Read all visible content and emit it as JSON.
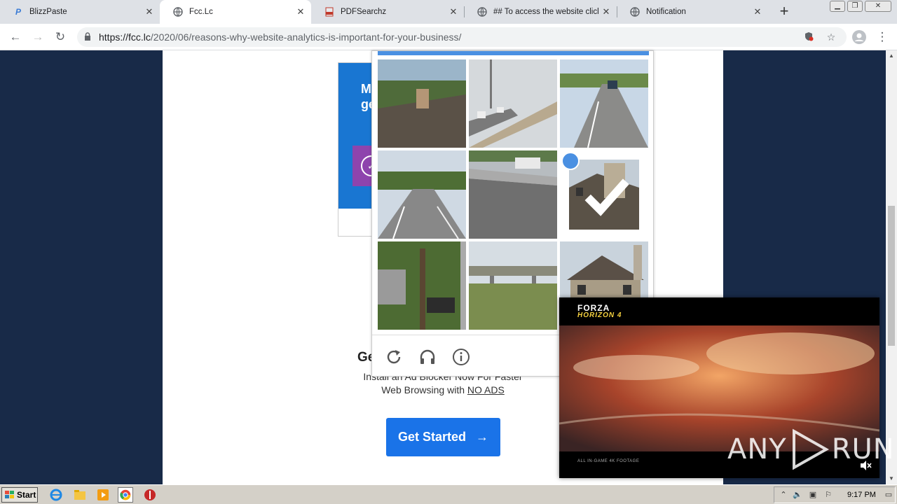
{
  "browser": {
    "tabs": [
      {
        "title": "BlizzPaste",
        "favicon": "blizzpaste-icon",
        "active": false
      },
      {
        "title": "Fcc.Lc",
        "favicon": "globe-icon",
        "active": true
      },
      {
        "title": "PDFSearchz",
        "favicon": "pdf-icon",
        "active": false
      },
      {
        "title": "## To access the website click t",
        "favicon": "globe-icon",
        "active": false
      },
      {
        "title": "Notification",
        "favicon": "globe-icon",
        "active": false
      }
    ],
    "new_tab_label": "+",
    "url_host": "https://fcc.lc",
    "url_path": "/2020/06/reasons-why-website-analytics-is-important-for-your-business/"
  },
  "page": {
    "ad_headline_line1": "M",
    "ad_headline_line2": "ge",
    "promo_heading": "Ge",
    "promo_line1": "Install an Ad Blocker Now For Faster",
    "promo_line2_prefix": "Web Browsing with ",
    "promo_line2_link": "NO ADS",
    "get_started_label": "Get Started",
    "get_started_arrow": "→"
  },
  "captcha": {
    "tiles": [
      {
        "scene": "house-roof",
        "selected": false
      },
      {
        "scene": "highway-overpass",
        "selected": false
      },
      {
        "scene": "road-with-car",
        "selected": false
      },
      {
        "scene": "highway",
        "selected": false
      },
      {
        "scene": "highway-barrier-car",
        "selected": false
      },
      {
        "scene": "house-chimney",
        "selected": true
      },
      {
        "scene": "tree-driveway",
        "selected": false
      },
      {
        "scene": "bridge-grass",
        "selected": false
      },
      {
        "scene": "house-suburb",
        "selected": false
      }
    ],
    "footer_icons": [
      "reload-icon",
      "audio-icon",
      "info-icon"
    ]
  },
  "video_ad": {
    "logo_title": "FORZA",
    "logo_subtitle": "HORIZON 4",
    "caption": "ALL IN-GAME 4K FOOTAGE"
  },
  "watermark": {
    "left": "ANY",
    "right": "RUN"
  },
  "taskbar": {
    "start_label": "Start",
    "clock": "9:17 PM"
  },
  "colors": {
    "page_bg": "#182a48",
    "accent_blue": "#1a73e8",
    "captcha_blue": "#4a90e2"
  }
}
